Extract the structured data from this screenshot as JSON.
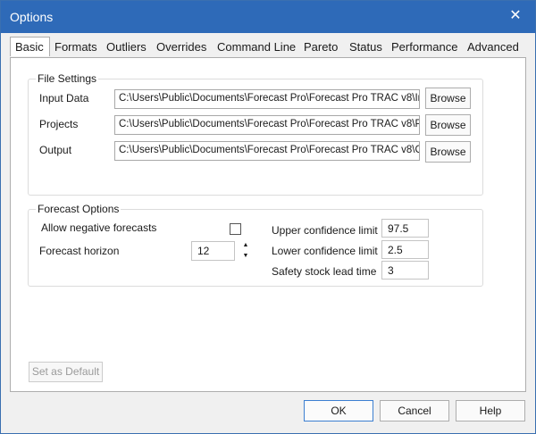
{
  "window": {
    "title": "Options",
    "close_glyph": "✕"
  },
  "tabs": [
    "Basic",
    "Formats",
    "Outliers",
    "Overrides",
    "Command Line",
    "Pareto",
    "Status",
    "Performance",
    "Advanced"
  ],
  "file_settings": {
    "legend": "File Settings",
    "rows": [
      {
        "label": "Input Data",
        "path": "C:\\Users\\Public\\Documents\\Forecast Pro\\Forecast Pro TRAC v8\\Ir",
        "button": "Browse"
      },
      {
        "label": "Projects",
        "path": "C:\\Users\\Public\\Documents\\Forecast Pro\\Forecast Pro TRAC v8\\P",
        "button": "Browse"
      },
      {
        "label": "Output",
        "path": "C:\\Users\\Public\\Documents\\Forecast Pro\\Forecast Pro TRAC v8\\C",
        "button": "Browse"
      }
    ]
  },
  "forecast_options": {
    "legend": "Forecast Options",
    "allow_negative_label": "Allow negative forecasts",
    "allow_negative_checked": false,
    "horizon_label": "Forecast horizon",
    "horizon_value": "12",
    "upper_label": "Upper confidence limit",
    "upper_value": "97.5",
    "lower_label": "Lower confidence limit",
    "lower_value": "2.5",
    "safety_label": "Safety stock lead time",
    "safety_value": "3"
  },
  "set_default_label": "Set as Default",
  "buttons": {
    "ok": "OK",
    "cancel": "Cancel",
    "help": "Help"
  },
  "colors": {
    "titlebar": "#2e6ab8",
    "default_button_border": "#3c7fd1"
  }
}
